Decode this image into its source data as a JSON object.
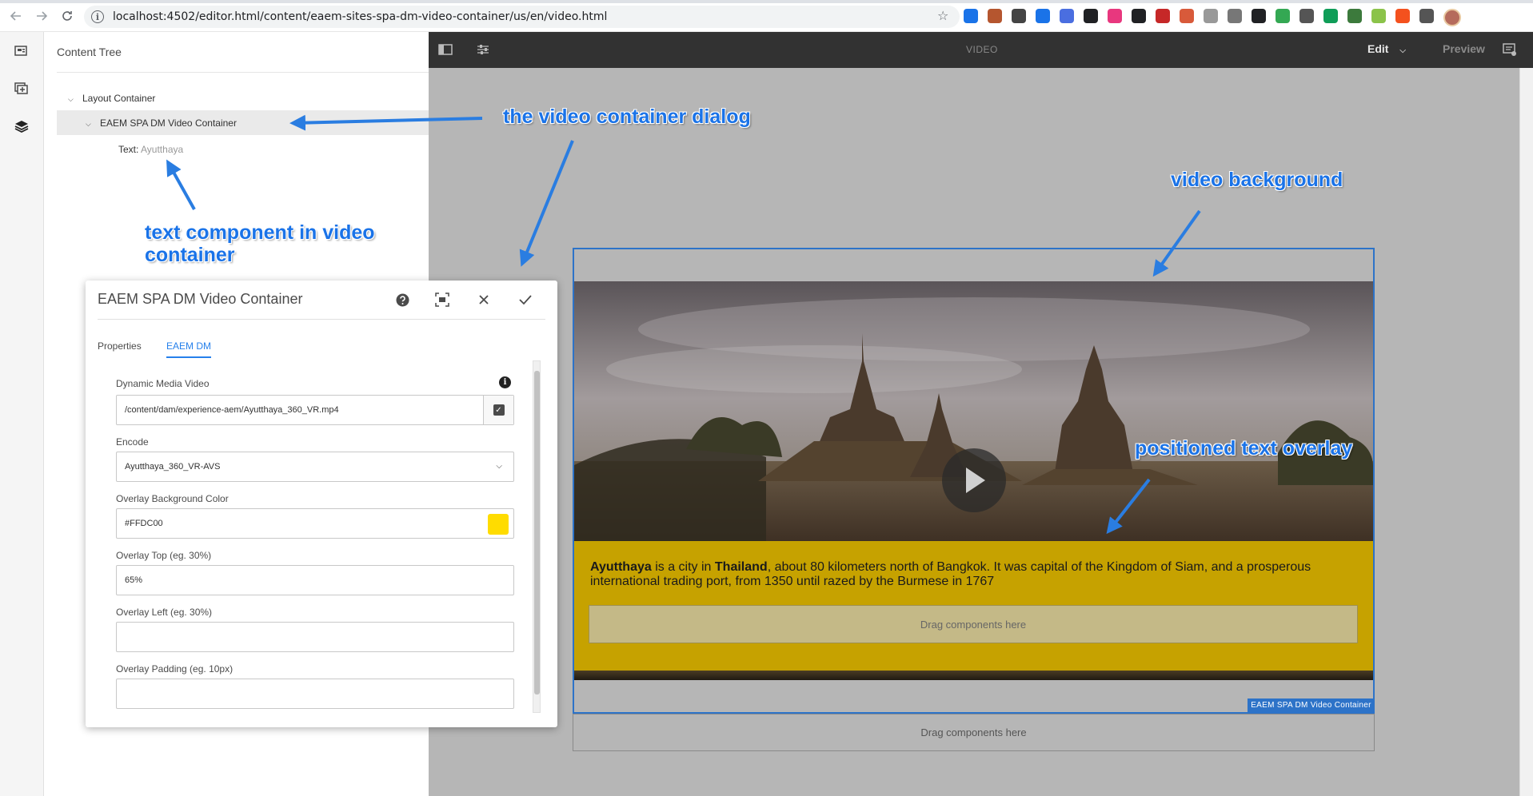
{
  "browser": {
    "url": "localhost:4502/editor.html/content/eaem-sites-spa-dm-video-container/us/en/video.html",
    "info_glyph": "i",
    "extensions": [
      "#1a73e8",
      "#b5562f",
      "#444444",
      "#1a73e8",
      "#4a6ee0",
      "#202124",
      "#e8377e",
      "#202124",
      "#c62828",
      "#d85a3a",
      "#999999",
      "#777777",
      "#202124",
      "#34a853",
      "#555555",
      "#0f9d58",
      "#3c7a3c",
      "#8bc34a",
      "#f4511e",
      "#555555"
    ]
  },
  "content_tree": {
    "title": "Content Tree",
    "items": [
      {
        "label": "Layout Container"
      },
      {
        "label": "EAEM SPA DM Video Container"
      },
      {
        "label": "Text:",
        "sub": "Ayutthaya"
      }
    ]
  },
  "annotations": {
    "dialog": "the video container dialog",
    "text_component_line1": "text component in video",
    "text_component_line2": "container",
    "video_background": "video background",
    "text_overlay": "positioned text overlay"
  },
  "editor": {
    "page_title": "VIDEO",
    "mode": "Edit",
    "preview": "Preview"
  },
  "video": {
    "overlay_bold_1": "Ayutthaya",
    "overlay_text_1": " is a city in ",
    "overlay_bold_2": "Thailand",
    "overlay_text_2": ", about 80 kilometers north of Bangkok. It was capital of the Kingdom of Siam, and a prosperous international trading port, from 1350 until razed by the Burmese in 1767",
    "drag_inner": "Drag components here",
    "container_label": "EAEM SPA DM Video Container",
    "drag_outer": "Drag components here"
  },
  "dialog": {
    "title": "EAEM SPA DM Video Container",
    "tabs": [
      {
        "label": "Properties"
      },
      {
        "label": "EAEM DM",
        "active": true
      }
    ],
    "fields": {
      "video_label": "Dynamic Media Video",
      "video_value": "/content/dam/experience-aem/Ayutthaya_360_VR.mp4",
      "encode_label": "Encode",
      "encode_value": "Ayutthaya_360_VR-AVS",
      "bg_color_label": "Overlay Background Color",
      "bg_color_value": "#FFDC00",
      "top_label": "Overlay Top (eg. 30%)",
      "top_value": "65%",
      "left_label": "Overlay Left (eg. 30%)",
      "left_value": "",
      "padding_label": "Overlay Padding (eg. 10px)",
      "padding_value": ""
    }
  },
  "colors": {
    "accent": "#2680eb",
    "annotation": "#1a73e8",
    "overlay_background": "#FFDC00",
    "container_border": "#2d73c8"
  }
}
